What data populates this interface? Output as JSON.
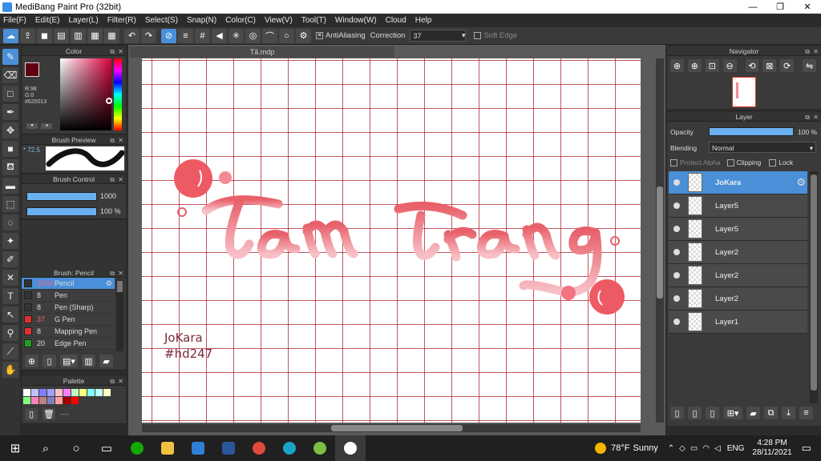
{
  "window": {
    "title": "MediBang Paint Pro (32bit)",
    "min": "—",
    "max": "❐",
    "close": "✕"
  },
  "menu": [
    "File(F)",
    "Edit(E)",
    "Layer(L)",
    "Filter(R)",
    "Select(S)",
    "Snap(N)",
    "Color(C)",
    "View(V)",
    "Tool(T)",
    "Window(W)",
    "Cloud",
    "Help"
  ],
  "toolbar": {
    "antialiasing_label": "AntiAliasing",
    "correction_label": "Correction",
    "correction_value": "37",
    "softedge_label": "Soft Edge"
  },
  "color_panel": {
    "title": "Color",
    "r": "R:98",
    "g": "G:0",
    "hex": "#620013",
    "primary": "#620013"
  },
  "brush_preview": {
    "title": "Brush Preview",
    "size": "* 72.5"
  },
  "brush_control": {
    "title": "Brush Control",
    "size": "1000",
    "opacity": "100 %"
  },
  "brush_list": {
    "title": "Brush: Pencil",
    "items": [
      {
        "size": "1000",
        "name": "Pencil",
        "color": "#333333"
      },
      {
        "size": "8",
        "name": "Pen",
        "color": "#333333"
      },
      {
        "size": "8",
        "name": "Pen (Sharp)",
        "color": "#333333"
      },
      {
        "size": "37",
        "name": "G Pen",
        "color": "#e03030"
      },
      {
        "size": "8",
        "name": "Mapping Pen",
        "color": "#e03030"
      },
      {
        "size": "20",
        "name": "Edge Pen",
        "color": "#20a020"
      }
    ]
  },
  "palette": {
    "title": "Palette",
    "dashes": "----",
    "colors": [
      "#ffffff",
      "#c0c0ff",
      "#8080ff",
      "#a0a0ff",
      "#ffc0c0",
      "#ff80ff",
      "#c0ffc0",
      "#ffff80",
      "#80ffff",
      "#c0ffff",
      "#ffffc0",
      "#80ff80",
      "#ff80c0",
      "#c08080",
      "#8080c0",
      "#ffa0a0",
      "#a00000",
      "#ff0000"
    ]
  },
  "document": {
    "tab": "Tâ.mdp"
  },
  "artwork": {
    "signature_line1": "JoKara",
    "signature_line2": "#hd247"
  },
  "navigator": {
    "title": "Navigator"
  },
  "layer_panel": {
    "title": "Layer",
    "opacity_label": "Opacity",
    "opacity_value": "100 %",
    "blending_label": "Blending",
    "blending_value": "Normal",
    "protect_alpha": "Protect Alpha",
    "clipping": "Clipping",
    "lock": "Lock",
    "layers": [
      {
        "name": "JoKara"
      },
      {
        "name": "Layer5"
      },
      {
        "name": "Layer5"
      },
      {
        "name": "Layer2"
      },
      {
        "name": "Layer2"
      },
      {
        "name": "Layer2"
      },
      {
        "name": "Layer1"
      }
    ]
  },
  "taskbar": {
    "weather_temp": "78°F",
    "weather_text": "Sunny",
    "lang": "ENG",
    "time": "4:28 PM",
    "date": "28/11/2021"
  }
}
